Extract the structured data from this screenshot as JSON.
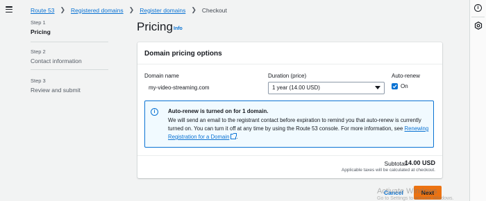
{
  "breadcrumb": {
    "items": [
      "Route 53",
      "Registered domains",
      "Register domains"
    ],
    "current": "Checkout"
  },
  "steps": [
    {
      "num": "Step 1",
      "title": "Pricing"
    },
    {
      "num": "Step 2",
      "title": "Contact information"
    },
    {
      "num": "Step 3",
      "title": "Review and submit"
    }
  ],
  "page": {
    "title": "Pricing",
    "info": "Info"
  },
  "card": {
    "title": "Domain pricing options",
    "domain_label": "Domain name",
    "domain_value": "my-video-streaming.com",
    "duration_label": "Duration (price)",
    "duration_value": "1 year (14.00 USD)",
    "autorenew_label": "Auto-renew",
    "autorenew_option": "On",
    "autorenew_checked": true
  },
  "alert": {
    "title": "Auto-renew is turned on for 1 domain.",
    "body": "We will send an email to the registrant contact before expiration to remind you that auto-renew is currently turned on. You can turn it off at any time by using the Route 53 console. For more information, see",
    "link": "Renewing Registration for a Domain",
    "tail": "."
  },
  "summary": {
    "subtotal_label": "Subtotal:",
    "subtotal_value": "14.00 USD",
    "tax_note": "Applicable taxes will be calculated at checkout."
  },
  "footer": {
    "cancel": "Cancel",
    "next": "Next"
  },
  "watermark": {
    "title": "Activate Windows",
    "sub": "Go to Settings to activate Windows."
  },
  "colors": {
    "accent": "#0972d3",
    "primary_button": "#ec7211"
  }
}
